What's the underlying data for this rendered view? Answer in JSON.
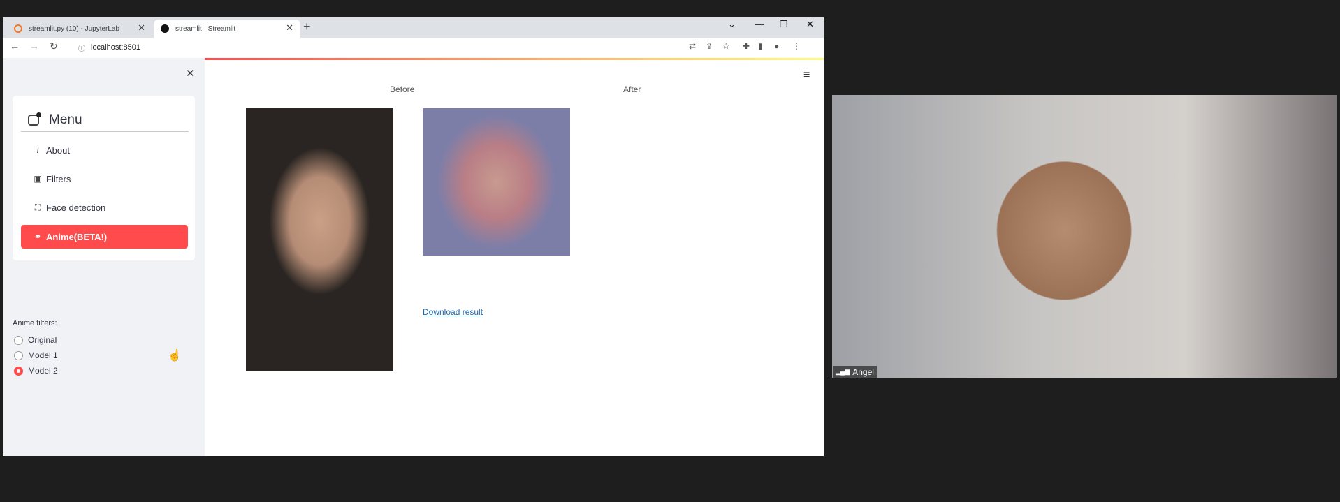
{
  "browser": {
    "tabs": [
      {
        "label": "streamlit.py (10) - JupyterLab",
        "favicon_color": "#f37726",
        "active": false
      },
      {
        "label": "streamlit · Streamlit",
        "favicon_color": "#111111",
        "active": true
      }
    ],
    "url": "localhost:8501"
  },
  "sidebar": {
    "menu_title": "Menu",
    "items": [
      {
        "label": "About",
        "icon": "info-icon",
        "active": false
      },
      {
        "label": "Filters",
        "icon": "image-icon",
        "active": false
      },
      {
        "label": "Face detection",
        "icon": "person-bounding-box-icon",
        "active": false
      },
      {
        "label": "Anime(BETA!)",
        "icon": "link-icon",
        "active": true
      }
    ],
    "filters_label": "Anime filters:",
    "radios": [
      {
        "label": "Original",
        "selected": false
      },
      {
        "label": "Model 1",
        "selected": false
      },
      {
        "label": "Model 2",
        "selected": true
      }
    ]
  },
  "main": {
    "before_caption": "Before",
    "after_caption": "After",
    "download_link": "Download result"
  },
  "webcam": {
    "participant_name": "Angel"
  },
  "colors": {
    "accent": "#ff4b4b",
    "sidebar_bg": "#f0f2f6",
    "link": "#1f6bb3"
  }
}
